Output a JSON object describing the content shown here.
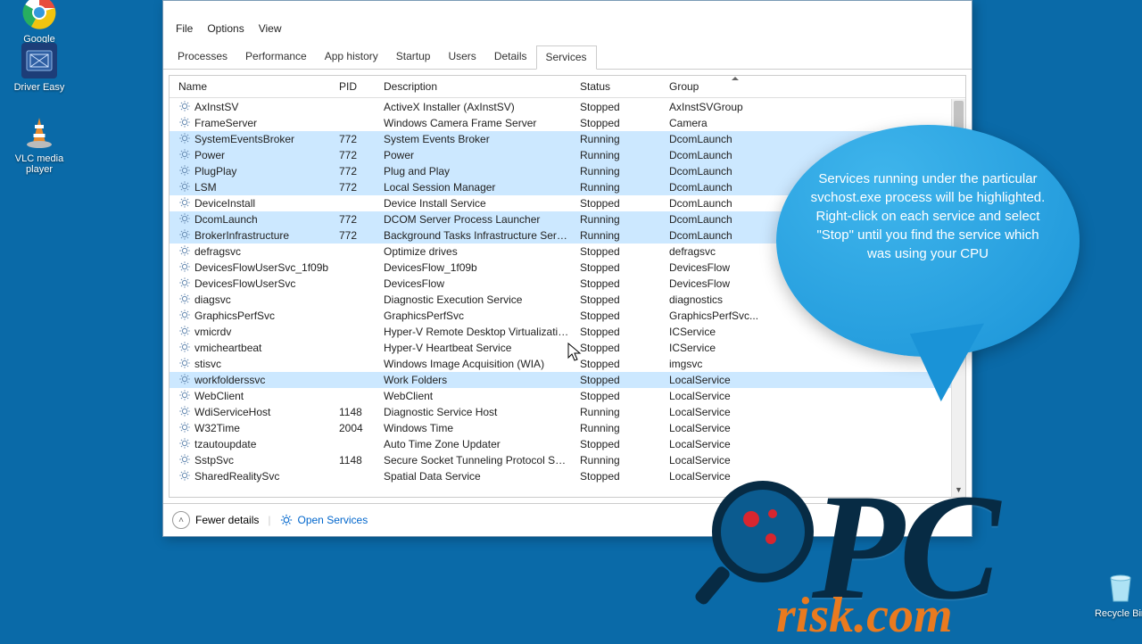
{
  "desktop": {
    "chrome": "Google Chrome",
    "drivereasy": "Driver Easy",
    "vlc": "VLC media player",
    "recycle": "Recycle Bin"
  },
  "menubar": {
    "file": "File",
    "options": "Options",
    "view": "View"
  },
  "tabs": {
    "processes": "Processes",
    "performance": "Performance",
    "apphistory": "App history",
    "startup": "Startup",
    "users": "Users",
    "details": "Details",
    "services": "Services"
  },
  "columns": {
    "name": "Name",
    "pid": "PID",
    "description": "Description",
    "status": "Status",
    "group": "Group"
  },
  "footer": {
    "fewer": "Fewer details",
    "open": "Open Services"
  },
  "callout": "Services running under the particular svchost.exe process will be highlighted. Right-click on each service and select \"Stop\" until you find the service which was using your CPU",
  "logo": {
    "pc": "PC",
    "risk": "risk.com"
  },
  "rows": [
    {
      "hl": false,
      "name": "AxInstSV",
      "pid": "",
      "desc": "ActiveX Installer (AxInstSV)",
      "status": "Stopped",
      "group": "AxInstSVGroup"
    },
    {
      "hl": false,
      "name": "FrameServer",
      "pid": "",
      "desc": "Windows Camera Frame Server",
      "status": "Stopped",
      "group": "Camera"
    },
    {
      "hl": true,
      "name": "SystemEventsBroker",
      "pid": "772",
      "desc": "System Events Broker",
      "status": "Running",
      "group": "DcomLaunch"
    },
    {
      "hl": true,
      "name": "Power",
      "pid": "772",
      "desc": "Power",
      "status": "Running",
      "group": "DcomLaunch"
    },
    {
      "hl": true,
      "name": "PlugPlay",
      "pid": "772",
      "desc": "Plug and Play",
      "status": "Running",
      "group": "DcomLaunch"
    },
    {
      "hl": true,
      "name": "LSM",
      "pid": "772",
      "desc": "Local Session Manager",
      "status": "Running",
      "group": "DcomLaunch"
    },
    {
      "hl": false,
      "name": "DeviceInstall",
      "pid": "",
      "desc": "Device Install Service",
      "status": "Stopped",
      "group": "DcomLaunch"
    },
    {
      "hl": true,
      "name": "DcomLaunch",
      "pid": "772",
      "desc": "DCOM Server Process Launcher",
      "status": "Running",
      "group": "DcomLaunch"
    },
    {
      "hl": true,
      "name": "BrokerInfrastructure",
      "pid": "772",
      "desc": "Background Tasks Infrastructure Service",
      "status": "Running",
      "group": "DcomLaunch"
    },
    {
      "hl": false,
      "name": "defragsvc",
      "pid": "",
      "desc": "Optimize drives",
      "status": "Stopped",
      "group": "defragsvc"
    },
    {
      "hl": false,
      "name": "DevicesFlowUserSvc_1f09b",
      "pid": "",
      "desc": "DevicesFlow_1f09b",
      "status": "Stopped",
      "group": "DevicesFlow"
    },
    {
      "hl": false,
      "name": "DevicesFlowUserSvc",
      "pid": "",
      "desc": "DevicesFlow",
      "status": "Stopped",
      "group": "DevicesFlow"
    },
    {
      "hl": false,
      "name": "diagsvc",
      "pid": "",
      "desc": "Diagnostic Execution Service",
      "status": "Stopped",
      "group": "diagnostics"
    },
    {
      "hl": false,
      "name": "GraphicsPerfSvc",
      "pid": "",
      "desc": "GraphicsPerfSvc",
      "status": "Stopped",
      "group": "GraphicsPerfSvc..."
    },
    {
      "hl": false,
      "name": "vmicrdv",
      "pid": "",
      "desc": "Hyper-V Remote Desktop Virtualizatio...",
      "status": "Stopped",
      "group": "ICService"
    },
    {
      "hl": false,
      "name": "vmicheartbeat",
      "pid": "",
      "desc": "Hyper-V Heartbeat Service",
      "status": "Stopped",
      "group": "ICService"
    },
    {
      "hl": false,
      "name": "stisvc",
      "pid": "",
      "desc": "Windows Image Acquisition (WIA)",
      "status": "Stopped",
      "group": "imgsvc"
    },
    {
      "hl": true,
      "name": "workfolderssvc",
      "pid": "",
      "desc": "Work Folders",
      "status": "Stopped",
      "group": "LocalService"
    },
    {
      "hl": false,
      "name": "WebClient",
      "pid": "",
      "desc": "WebClient",
      "status": "Stopped",
      "group": "LocalService"
    },
    {
      "hl": false,
      "name": "WdiServiceHost",
      "pid": "1148",
      "desc": "Diagnostic Service Host",
      "status": "Running",
      "group": "LocalService"
    },
    {
      "hl": false,
      "name": "W32Time",
      "pid": "2004",
      "desc": "Windows Time",
      "status": "Running",
      "group": "LocalService"
    },
    {
      "hl": false,
      "name": "tzautoupdate",
      "pid": "",
      "desc": "Auto Time Zone Updater",
      "status": "Stopped",
      "group": "LocalService"
    },
    {
      "hl": false,
      "name": "SstpSvc",
      "pid": "1148",
      "desc": "Secure Socket Tunneling Protocol Ser...",
      "status": "Running",
      "group": "LocalService"
    },
    {
      "hl": false,
      "name": "SharedRealitySvc",
      "pid": "",
      "desc": "Spatial Data Service",
      "status": "Stopped",
      "group": "LocalService"
    }
  ]
}
